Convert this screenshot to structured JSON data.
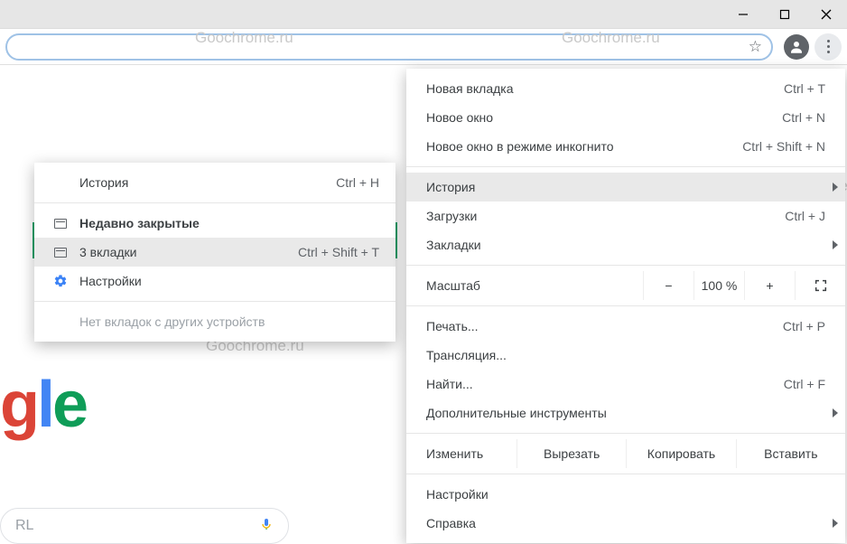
{
  "watermark_text": "Goochrome.ru",
  "titlebar": {
    "min": "minimize",
    "max": "maximize",
    "close": "close"
  },
  "omnibox": {
    "placeholder": "RL"
  },
  "main_menu": {
    "new_tab": {
      "label": "Новая вкладка",
      "shortcut": "Ctrl + T"
    },
    "new_win": {
      "label": "Новое окно",
      "shortcut": "Ctrl + N"
    },
    "incognito": {
      "label": "Новое окно в режиме инкогнито",
      "shortcut": "Ctrl + Shift + N"
    },
    "history": {
      "label": "История"
    },
    "downloads": {
      "label": "Загрузки",
      "shortcut": "Ctrl + J"
    },
    "bookmarks": {
      "label": "Закладки"
    },
    "zoom": {
      "label": "Масштаб",
      "minus": "−",
      "value": "100 %",
      "plus": "+"
    },
    "print": {
      "label": "Печать...",
      "shortcut": "Ctrl + P"
    },
    "cast": {
      "label": "Трансляция..."
    },
    "find": {
      "label": "Найти...",
      "shortcut": "Ctrl + F"
    },
    "more_tools": {
      "label": "Дополнительные инструменты"
    },
    "edit": {
      "label": "Изменить",
      "cut": "Вырезать",
      "copy": "Копировать",
      "paste": "Вставить"
    },
    "settings": {
      "label": "Настройки"
    },
    "help": {
      "label": "Справка"
    }
  },
  "history_submenu": {
    "history": {
      "label": "История",
      "shortcut": "Ctrl + H"
    },
    "recent_hdr": {
      "label": "Недавно закрытые"
    },
    "restore": {
      "label": "3 вкладки",
      "shortcut": "Ctrl + Shift + T"
    },
    "settings": {
      "label": "Настройки"
    },
    "no_other": {
      "label": "Нет вкладок с других устройств"
    }
  }
}
